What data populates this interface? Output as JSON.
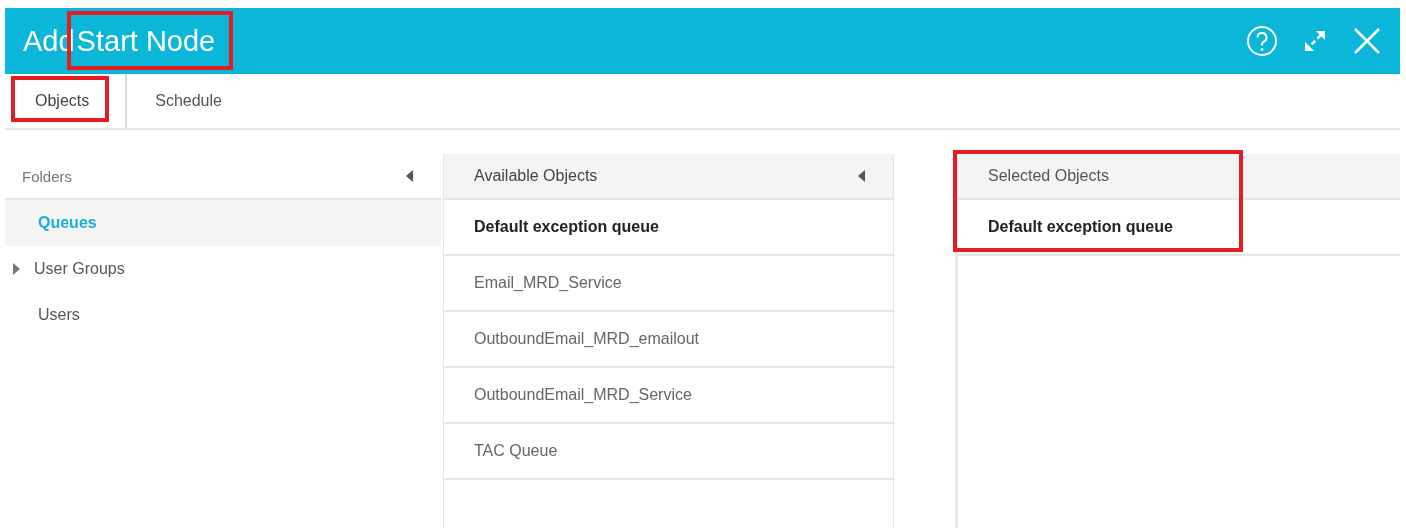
{
  "window": {
    "title_prefix": "Add",
    "title_main": "Start Node",
    "title_main_highlighted": true
  },
  "tabs": [
    {
      "label": "Objects",
      "selected": true,
      "highlighted": true
    },
    {
      "label": "Schedule",
      "selected": false,
      "highlighted": false
    }
  ],
  "folders": {
    "header": "Folders",
    "items": [
      {
        "label": "Queues",
        "selected": true,
        "expandable": false
      },
      {
        "label": "User Groups",
        "selected": false,
        "expandable": true
      },
      {
        "label": "Users",
        "selected": false,
        "expandable": false
      }
    ]
  },
  "available": {
    "header": "Available Objects",
    "items": [
      {
        "label": "Default exception queue",
        "selected": true
      },
      {
        "label": "Email_MRD_Service",
        "selected": false
      },
      {
        "label": "OutboundEmail_MRD_emailout",
        "selected": false
      },
      {
        "label": "OutboundEmail_MRD_Service",
        "selected": false
      },
      {
        "label": "TAC Queue",
        "selected": false
      }
    ]
  },
  "selected_objects": {
    "header": "Selected Objects",
    "highlighted": true,
    "items": [
      {
        "label": "Default exception queue",
        "selected": true
      }
    ]
  }
}
